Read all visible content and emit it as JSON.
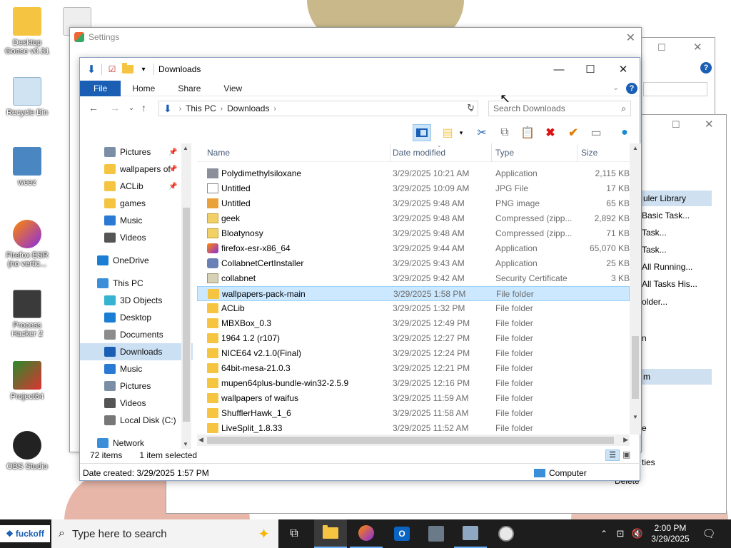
{
  "desktop": {
    "icons": [
      {
        "label": "Desktop Goose v0.31",
        "line1": "Desktop",
        "line2": "Goose v0.31"
      },
      {
        "label": "Recycle Bin"
      },
      {
        "label": "weez"
      },
      {
        "label": "Firefox ESR (no vertic...",
        "line1": "Firefox ESR",
        "line2": "(no vertic..."
      },
      {
        "label": "Process Hacker 2",
        "line1": "Process",
        "line2": "Hacker 2"
      },
      {
        "label": "Project64"
      },
      {
        "label": "OBS Studio"
      }
    ]
  },
  "settings_window": {
    "title": "Settings",
    "close": "✕"
  },
  "background_window": {
    "items": [
      "uler Library",
      "Basic Task...",
      "Task...",
      "Task...",
      "All Running...",
      "All Tasks His...",
      "older...",
      "n",
      "m",
      "e",
      "ties",
      "Delete"
    ]
  },
  "explorer": {
    "title": "Downloads",
    "controls": {
      "minimize": "—",
      "maximize": "☐",
      "close": "✕"
    },
    "ribbon_tabs": [
      "File",
      "Home",
      "Share",
      "View"
    ],
    "address": {
      "segments": [
        "This PC",
        "Downloads"
      ]
    },
    "search_placeholder": "Search Downloads",
    "nav": [
      {
        "label": "Pictures",
        "icon": "pictures-icon",
        "pinned": true,
        "indent": 1
      },
      {
        "label": "wallpapers of",
        "icon": "folder-icon",
        "pinned": true,
        "indent": 1
      },
      {
        "label": "ACLib",
        "icon": "folder-icon",
        "pinned": true,
        "indent": 1
      },
      {
        "label": "games",
        "icon": "folder-icon",
        "pinned": false,
        "indent": 1
      },
      {
        "label": "Music",
        "icon": "music-icon",
        "pinned": false,
        "indent": 1
      },
      {
        "label": "Videos",
        "icon": "videos-icon",
        "pinned": false,
        "indent": 1
      },
      {
        "label": "",
        "icon": "",
        "pinned": false,
        "indent": 0
      },
      {
        "label": "OneDrive",
        "icon": "onedrive-icon",
        "pinned": false,
        "indent": 0
      },
      {
        "label": "",
        "icon": "",
        "pinned": false,
        "indent": 0
      },
      {
        "label": "This PC",
        "icon": "this-pc-icon",
        "pinned": false,
        "indent": 0
      },
      {
        "label": "3D Objects",
        "icon": "3d-objects-icon",
        "pinned": false,
        "indent": 1
      },
      {
        "label": "Desktop",
        "icon": "desktop-icon",
        "pinned": false,
        "indent": 1
      },
      {
        "label": "Documents",
        "icon": "documents-icon",
        "pinned": false,
        "indent": 1
      },
      {
        "label": "Downloads",
        "icon": "downloads-icon",
        "pinned": false,
        "indent": 1,
        "selected": true
      },
      {
        "label": "Music",
        "icon": "music-icon",
        "pinned": false,
        "indent": 1
      },
      {
        "label": "Pictures",
        "icon": "pictures-icon",
        "pinned": false,
        "indent": 1
      },
      {
        "label": "Videos",
        "icon": "videos-icon",
        "pinned": false,
        "indent": 1
      },
      {
        "label": "Local Disk (C:)",
        "icon": "local-disk-icon",
        "pinned": false,
        "indent": 1
      },
      {
        "label": "",
        "icon": "",
        "pinned": false,
        "indent": 0
      },
      {
        "label": "Network",
        "icon": "network-icon",
        "pinned": false,
        "indent": 0
      }
    ],
    "columns": {
      "name": "Name",
      "date": "Date modified",
      "type": "Type",
      "size": "Size"
    },
    "files": [
      {
        "name": "Polydimethylsiloxane",
        "date": "3/29/2025 10:21 AM",
        "type": "Application",
        "size": "2,115 KB",
        "icon": "app"
      },
      {
        "name": "Untitled",
        "date": "3/29/2025 10:09 AM",
        "type": "JPG File",
        "size": "17 KB",
        "icon": "jpg"
      },
      {
        "name": "Untitled",
        "date": "3/29/2025 9:48 AM",
        "type": "PNG image",
        "size": "65 KB",
        "icon": "png"
      },
      {
        "name": "geek",
        "date": "3/29/2025 9:48 AM",
        "type": "Compressed (zipp...",
        "size": "2,892 KB",
        "icon": "zip"
      },
      {
        "name": "Bloatynosy",
        "date": "3/29/2025 9:48 AM",
        "type": "Compressed (zipp...",
        "size": "71 KB",
        "icon": "zip"
      },
      {
        "name": "firefox-esr-x86_64",
        "date": "3/29/2025 9:44 AM",
        "type": "Application",
        "size": "65,070 KB",
        "icon": "ff"
      },
      {
        "name": "CollabnetCertInstaller",
        "date": "3/29/2025 9:43 AM",
        "type": "Application",
        "size": "25 KB",
        "icon": "cab"
      },
      {
        "name": "collabnet",
        "date": "3/29/2025 9:42 AM",
        "type": "Security Certificate",
        "size": "3 KB",
        "icon": "cert"
      },
      {
        "name": "wallpapers-pack-main",
        "date": "3/29/2025 1:58 PM",
        "type": "File folder",
        "size": "",
        "icon": "folder",
        "selected": true
      },
      {
        "name": "ACLib",
        "date": "3/29/2025 1:32 PM",
        "type": "File folder",
        "size": "",
        "icon": "folder"
      },
      {
        "name": "MBXBox_0.3",
        "date": "3/29/2025 12:49 PM",
        "type": "File folder",
        "size": "",
        "icon": "folder"
      },
      {
        "name": "1964 1.2 (r107)",
        "date": "3/29/2025 12:27 PM",
        "type": "File folder",
        "size": "",
        "icon": "folder"
      },
      {
        "name": "NICE64 v2.1.0(Final)",
        "date": "3/29/2025 12:24 PM",
        "type": "File folder",
        "size": "",
        "icon": "folder"
      },
      {
        "name": "64bit-mesa-21.0.3",
        "date": "3/29/2025 12:21 PM",
        "type": "File folder",
        "size": "",
        "icon": "folder"
      },
      {
        "name": "mupen64plus-bundle-win32-2.5.9",
        "date": "3/29/2025 12:16 PM",
        "type": "File folder",
        "size": "",
        "icon": "folder"
      },
      {
        "name": "wallpapers of waifus",
        "date": "3/29/2025 11:59 AM",
        "type": "File folder",
        "size": "",
        "icon": "folder"
      },
      {
        "name": "ShufflerHawk_1_6",
        "date": "3/29/2025 11:58 AM",
        "type": "File folder",
        "size": "",
        "icon": "folder"
      },
      {
        "name": "LiveSplit_1.8.33",
        "date": "3/29/2025 11:52 AM",
        "type": "File folder",
        "size": "",
        "icon": "folder"
      }
    ],
    "status": {
      "count": "72 items",
      "selection": "1 item selected"
    },
    "details": {
      "created": "Date created: 3/29/2025 1:57 PM",
      "location": "Computer"
    }
  },
  "taskbar": {
    "start_label": "fuckoff",
    "search_placeholder": "Type here to search",
    "time": "2:00 PM",
    "date": "3/29/2025"
  },
  "colors": {
    "accent": "#1a5fb4",
    "selection": "#cce8ff",
    "taskbar": "#1d1d1d"
  }
}
